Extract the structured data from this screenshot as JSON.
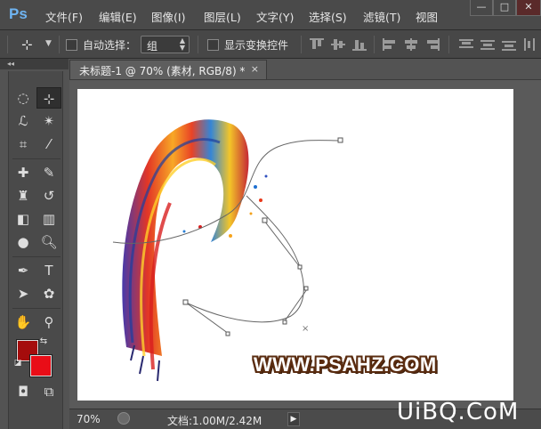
{
  "app": {
    "logo": "Ps"
  },
  "menu": [
    "文件(F)",
    "编辑(E)",
    "图像(I)",
    "图层(L)",
    "文字(Y)",
    "选择(S)",
    "滤镜(T)",
    "视图"
  ],
  "window_buttons": [
    "—",
    "□",
    "✕"
  ],
  "options": {
    "auto_select_label": "自动选择：",
    "auto_select_value": "组",
    "show_transform_label": "显示变换控件",
    "auto_select_checked": false,
    "show_transform_checked": false
  },
  "document": {
    "tab_title": "未标题-1 @ 70% (素材, RGB/8) *",
    "close_glyph": "×",
    "watermark": "WWW.PSAHZ.COM"
  },
  "status": {
    "zoom": "70%",
    "doc_info": "文档:1.00M/2.42M",
    "arrow": "▶"
  },
  "colors": {
    "foreground": "#a50c0c",
    "background": "#e90d17",
    "ps_blue": "#6fb4f2"
  },
  "site_mark": "UiBQ.CoM",
  "tools": [
    "marquee-icon",
    "move-icon",
    "lasso-icon",
    "magic-wand-icon",
    "crop-icon",
    "eyedropper-icon",
    "healing-brush-icon",
    "brush-icon",
    "clone-stamp-icon",
    "history-brush-icon",
    "eraser-icon",
    "gradient-icon",
    "blur-icon",
    "dodge-icon",
    "pen-icon",
    "type-icon",
    "path-select-icon",
    "shape-icon",
    "hand-icon",
    "zoom-icon",
    "quick-mask-icon",
    "screen-mode-icon"
  ]
}
